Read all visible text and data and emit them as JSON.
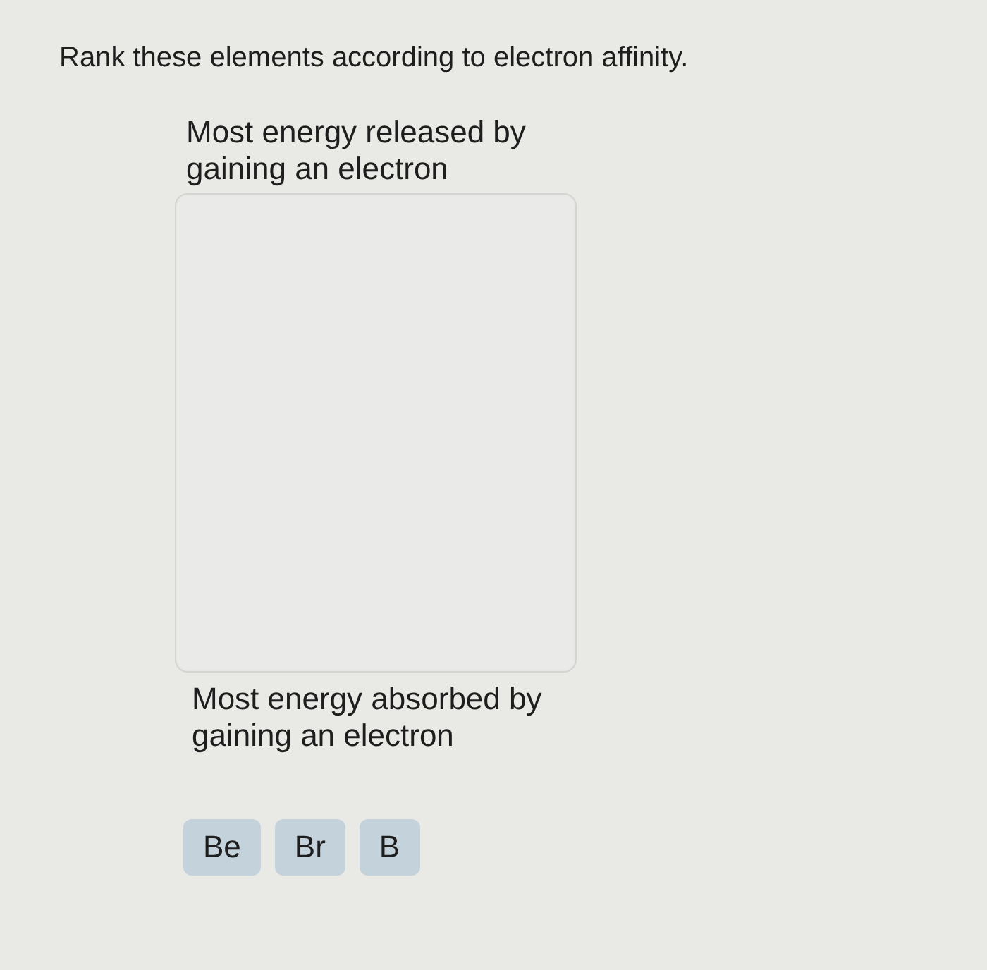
{
  "prompt": "Rank these elements according to electron affinity.",
  "top_label": "Most energy released by gaining an electron",
  "bottom_label": "Most energy absorbed by gaining an electron",
  "choices": [
    {
      "label": "Be"
    },
    {
      "label": "Br"
    },
    {
      "label": "B"
    }
  ]
}
